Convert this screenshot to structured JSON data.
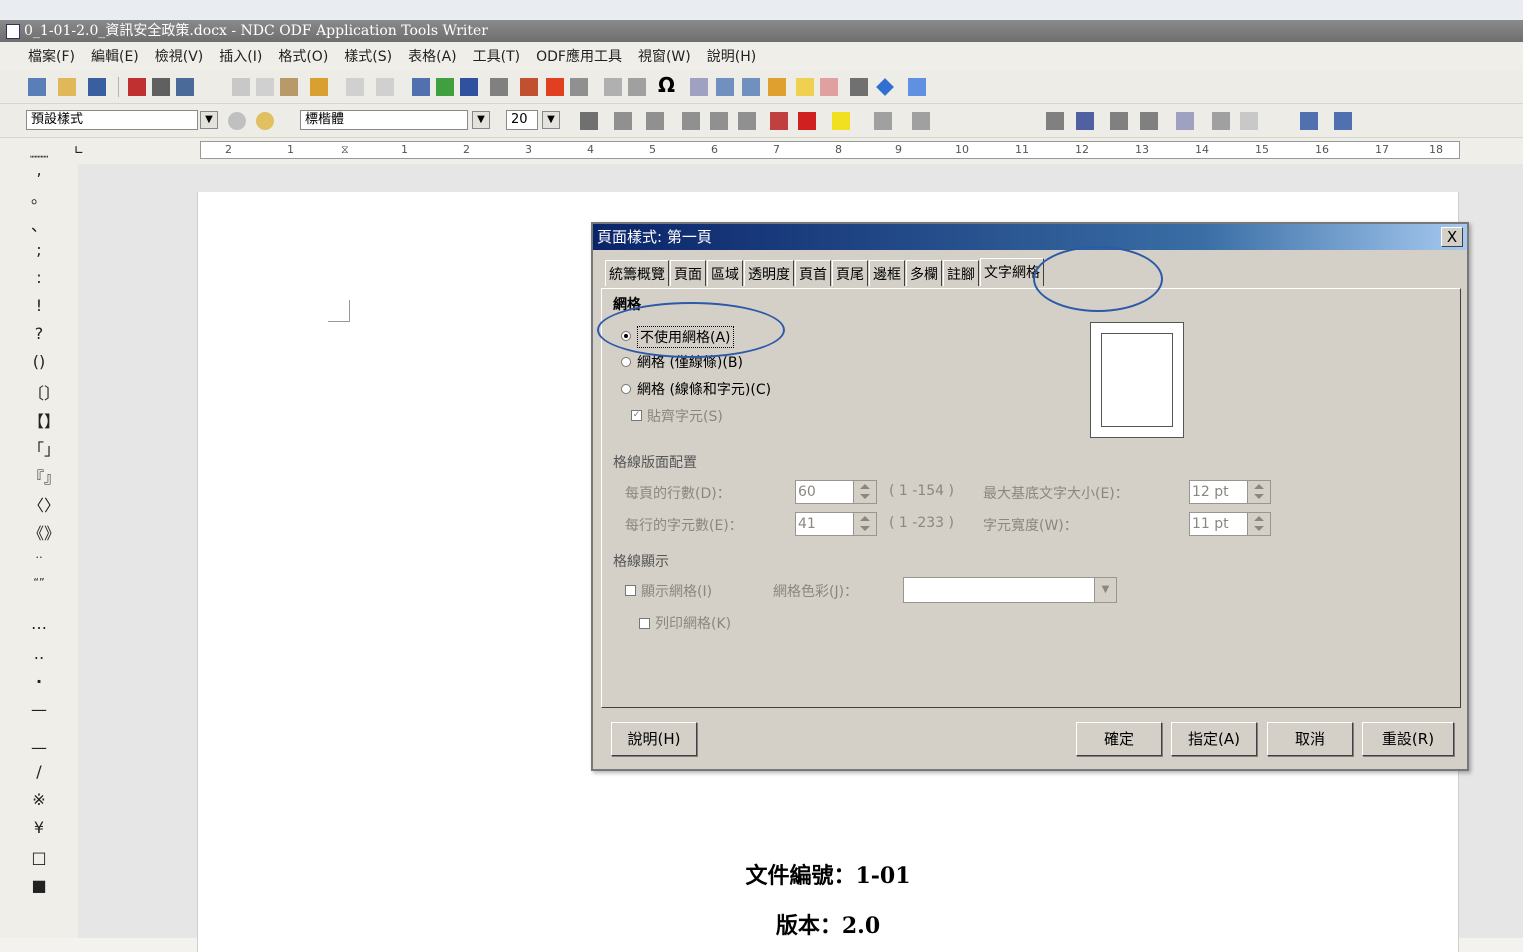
{
  "window": {
    "title": "0_1-01-2.0_資訊安全政策.docx - NDC ODF Application Tools Writer"
  },
  "menubar": [
    "檔案(F)",
    "編輯(E)",
    "檢視(V)",
    "插入(I)",
    "格式(O)",
    "樣式(S)",
    "表格(A)",
    "工具(T)",
    "ODF應用工具",
    "視窗(W)",
    "說明(H)"
  ],
  "format_toolbar": {
    "paragraph_style": "預設樣式",
    "font_name": "標楷體",
    "font_size": "20"
  },
  "ruler": {
    "ticks": [
      "2",
      "1",
      "1",
      "2",
      "3",
      "4",
      "5",
      "6",
      "7",
      "8",
      "9",
      "10",
      "11",
      "12",
      "13",
      "14",
      "15",
      "16",
      "17",
      "18"
    ]
  },
  "sidebar_punctuation": [
    ",",
    "。",
    "、",
    ";",
    ":",
    "!",
    "?",
    "()",
    "〔〕",
    "【】",
    "「」",
    "『』",
    "〈〉",
    "《》",
    "‥",
    "“”",
    "…",
    "‥",
    "·",
    "—",
    "—",
    "/",
    "※",
    "¥",
    "□",
    "■"
  ],
  "document": {
    "doc_number": "文件編號：1-01",
    "version": "版本：2.0"
  },
  "dialog": {
    "title": "頁面樣式: 第一頁",
    "close": "X",
    "tabs": [
      "統籌概覽",
      "頁面",
      "區域",
      "透明度",
      "頁首",
      "頁尾",
      "邊框",
      "多欄",
      "註腳",
      "文字網格"
    ],
    "active_tab": "文字網格",
    "grid_section": "網格",
    "options": {
      "no_grid": "不使用網格(A)",
      "grid_lines": "網格 (僅線條)(B)",
      "grid_lines_chars": "網格 (線條和字元)(C)",
      "snap_chars": "貼齊字元(S)"
    },
    "layout_section": "格線版面配置",
    "lines_per_page_label": "每頁的行數(D)：",
    "lines_per_page_value": "60",
    "lines_range": "( 1 -154 )",
    "max_base_size_label": "最大基底文字大小(E)：",
    "max_base_size_value": "12 pt",
    "chars_per_line_label": "每行的字元數(E)：",
    "chars_per_line_value": "41",
    "chars_range": "( 1 -233 )",
    "char_width_label": "字元寬度(W)：",
    "char_width_value": "11 pt",
    "display_section": "格線顯示",
    "show_grid": "顯示網格(I)",
    "grid_color_label": "網格色彩(J)：",
    "print_grid": "列印網格(K)",
    "buttons": {
      "help": "說明(H)",
      "ok": "確定",
      "apply": "指定(A)",
      "cancel": "取消",
      "reset": "重設(R)"
    }
  }
}
